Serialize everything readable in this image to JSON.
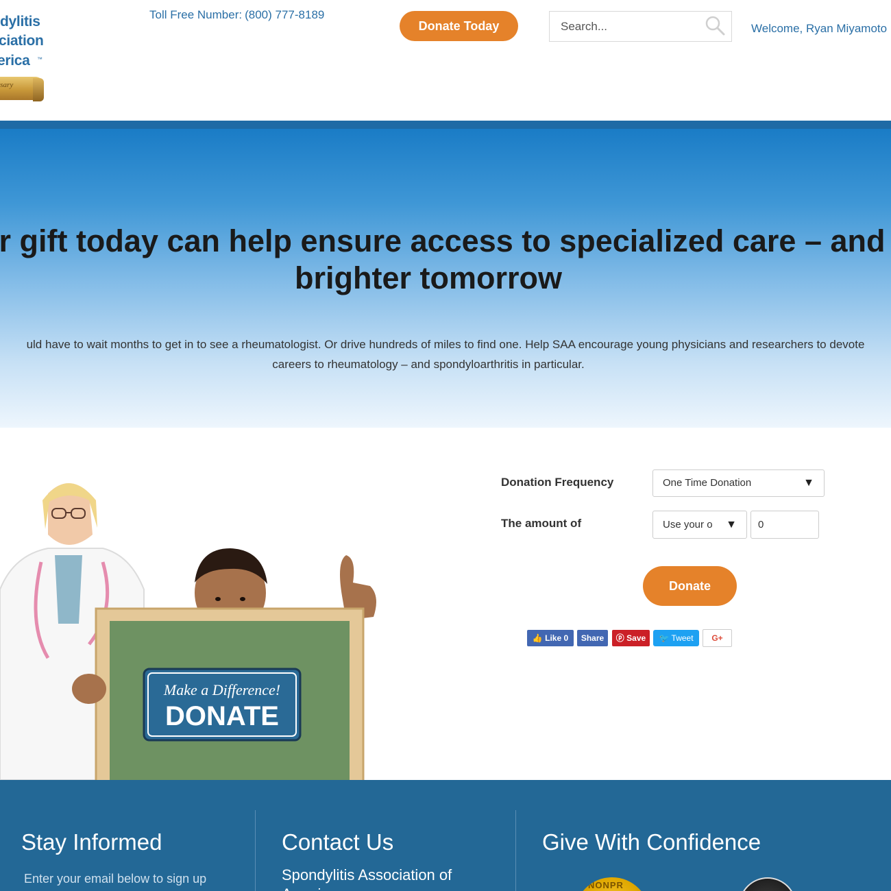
{
  "header": {
    "logo_lines": [
      "dylitis",
      "ciation",
      "erica"
    ],
    "logo_tm": "™",
    "logo_ribbon": "rsary",
    "tollfree_label": "Toll Free Number:",
    "tollfree_number": "(800) 777-8189",
    "donate_button": "Donate Today",
    "search_placeholder": "Search...",
    "welcome": "Welcome, Ryan Miyamoto"
  },
  "hero": {
    "title_line1": "ur gift today can help ensure access to specialized care – and a",
    "title_line2": "brighter tomorrow",
    "text_line1": "uld have to wait months to get in to see a rheumatologist. Or drive hundreds of miles to find one. Help SAA encourage young physicians and researchers to devote",
    "text_line2": "careers to rheumatology – and spondyloarthritis in particular."
  },
  "illustration": {
    "sign_script": "Make a Difference!",
    "sign_main": "DONATE"
  },
  "form": {
    "frequency_label": "Donation Frequency",
    "frequency_value": "One Time Donation",
    "amount_label": "The amount of",
    "amount_select_value": "Use your o",
    "amount_value": "0",
    "donate_button": "Donate"
  },
  "social": {
    "like": "Like 0",
    "share": "Share",
    "save": "Save",
    "tweet": "Tweet",
    "gplus": "G+"
  },
  "footer": {
    "stay_informed": "Stay Informed",
    "stay_informed_sub": "Enter your email below to sign up",
    "contact_us": "Contact Us",
    "contact_line1": "Spondylitis Association of",
    "contact_line2": "America",
    "give_confidence": "Give With Confidence",
    "seal_text": "NONPR"
  },
  "colors": {
    "brand_blue": "#2a6fa6",
    "accent_orange": "#e5822a",
    "footer_blue": "#236896",
    "bar_blue": "#1f6aa5"
  }
}
